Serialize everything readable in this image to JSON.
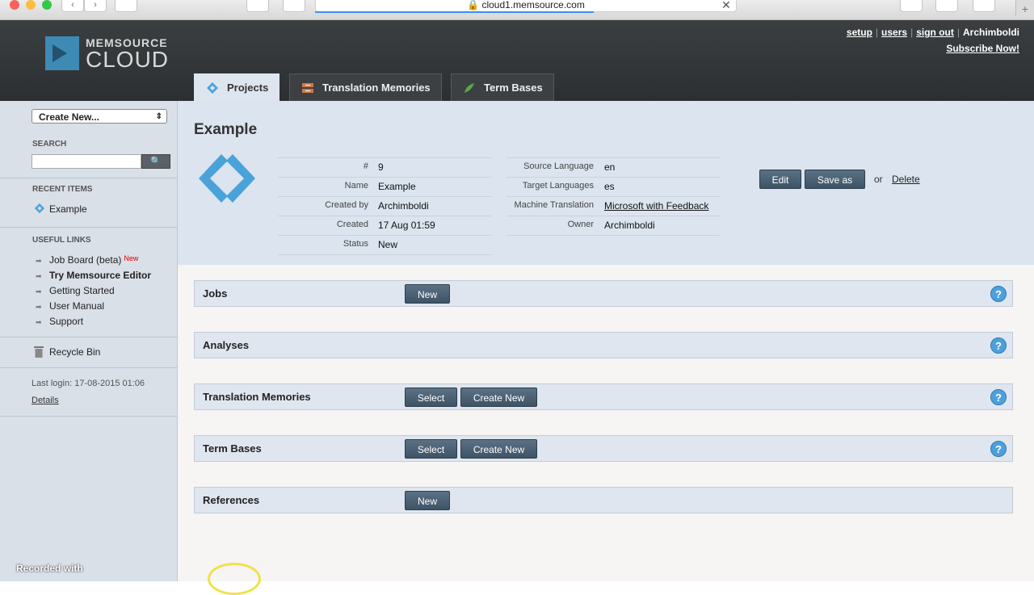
{
  "browser": {
    "url": "cloud1.memsource.com",
    "back": "‹",
    "forward": "›",
    "close": "✕",
    "new_tab": "+"
  },
  "header": {
    "logo_line1": "MEMSOURCE",
    "logo_line2": "CLOUD",
    "links": [
      "setup",
      "users",
      "sign out"
    ],
    "user": "Archimboldi",
    "subscribe": "Subscribe Now!",
    "tabs": [
      {
        "label": "Projects",
        "icon": "projects-icon"
      },
      {
        "label": "Translation Memories",
        "icon": "translation-memories-icon"
      },
      {
        "label": "Term Bases",
        "icon": "term-bases-icon"
      }
    ]
  },
  "sidebar": {
    "create_select": "Create New...",
    "search_label": "SEARCH",
    "search_button": "🔍",
    "recent_label": "RECENT ITEMS",
    "recent_items": [
      "Example"
    ],
    "useful_label": "USEFUL LINKS",
    "useful_links": [
      "Job Board (beta)",
      "Try Memsource Editor",
      "Getting Started",
      "User Manual",
      "Support"
    ],
    "new_badge": "New",
    "recycle_bin": "Recycle Bin",
    "last_login": "Last login: 17-08-2015 01:06",
    "details": "Details"
  },
  "project": {
    "title": "Example",
    "left_fields": [
      {
        "label": "#",
        "value": "9"
      },
      {
        "label": "Name",
        "value": "Example"
      },
      {
        "label": "Created by",
        "value": "Archimboldi"
      },
      {
        "label": "Created",
        "value": "17 Aug 01:59"
      },
      {
        "label": "Status",
        "value": "New"
      }
    ],
    "right_fields": [
      {
        "label": "Source Language",
        "value": "en"
      },
      {
        "label": "Target Languages",
        "value": "es"
      },
      {
        "label": "Machine Translation",
        "value": "Microsoft with Feedback"
      },
      {
        "label": "Owner",
        "value": "Archimboldi"
      }
    ],
    "edit": "Edit",
    "save_as": "Save as",
    "or": "or",
    "delete": "Delete"
  },
  "sections": [
    {
      "title": "Jobs",
      "buttons": [
        "New"
      ],
      "help": true
    },
    {
      "title": "Analyses",
      "buttons": [],
      "help": true
    },
    {
      "title": "Translation Memories",
      "buttons": [
        "Select",
        "Create New"
      ],
      "help": true
    },
    {
      "title": "Term Bases",
      "buttons": [
        "Select",
        "Create New"
      ],
      "help": true
    },
    {
      "title": "References",
      "buttons": [
        "New"
      ],
      "help": false
    }
  ],
  "help_glyph": "?",
  "overlay": {
    "recorded_with": "Recorded with"
  }
}
